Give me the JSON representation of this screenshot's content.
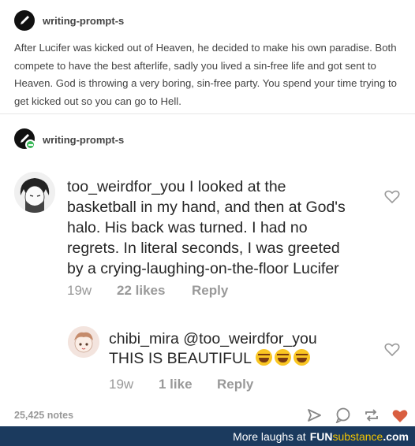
{
  "post": {
    "blog_name": "writing-prompt-s",
    "body": "After Lucifer was kicked out of Heaven, he decided to make his own paradise. Both compete to have the best afterlife, sadly you lived a sin-free life and got sent to Heaven. God is throwing a very boring, sin-free party. You spend your time trying to get kicked out so you can go to Hell."
  },
  "reblog": {
    "blog_name": "writing-prompt-s"
  },
  "comments": [
    {
      "username": "too_weirdfor_you",
      "lines": [
        " I looked at the",
        "basketball in my hand, and then at God's",
        "halo. His back was turned. I had no",
        "regrets. In literal seconds, I was greeted",
        "by a crying-laughing-on-the-floor Lucifer"
      ],
      "age": "19w",
      "likes": "22 likes",
      "reply": "Reply"
    },
    {
      "username": "chibi_mira",
      "mention": " @too_weirdfor_you",
      "text": "THIS IS BEAUTIFUL ",
      "age": "19w",
      "likes": "1 like",
      "reply": "Reply"
    }
  ],
  "footer": {
    "notes": "25,425 notes",
    "banner_text": "More laughs at",
    "brand_main": "FUN",
    "brand_sub": "substance",
    "brand_tld": ".com",
    "colors": {
      "banner_bg": "#1b3a5e",
      "accent": "#f3c500",
      "like_heart": "#d95e40"
    }
  }
}
